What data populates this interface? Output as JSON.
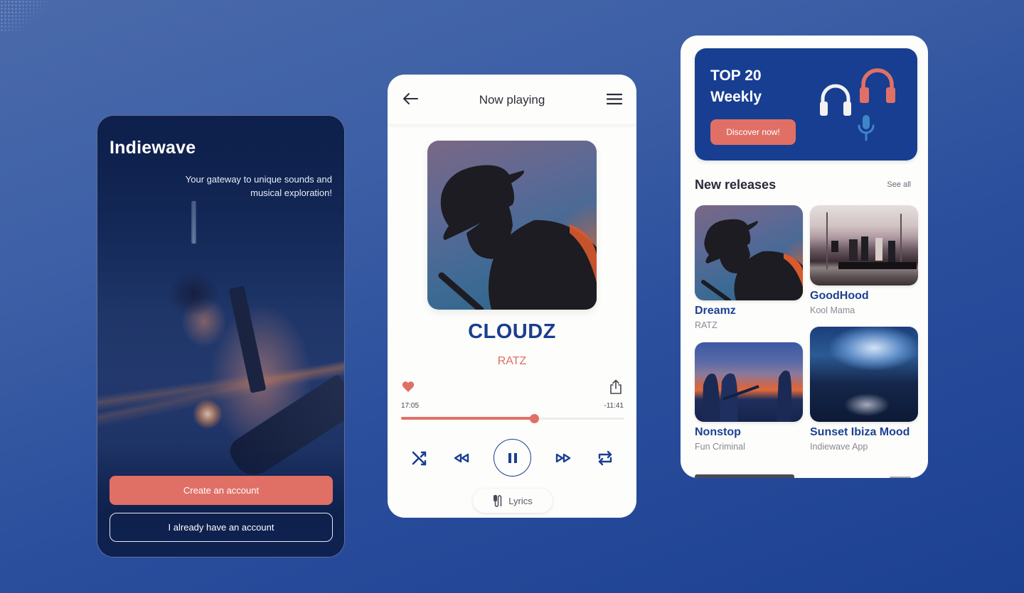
{
  "colors": {
    "primary_blue": "#1a3e8f",
    "coral": "#e07066",
    "dark_navy": "#0f2150",
    "card_bg": "#fdfdfb",
    "mic_blue": "#3f86c8"
  },
  "onboarding": {
    "brand": "Indiewave",
    "tagline": "Your gateway to unique sounds and musical exploration!",
    "create_account_label": "Create an account",
    "login_label": "I already have an account"
  },
  "player": {
    "header": {
      "back_icon": "arrow-left-icon",
      "title": "Now playing",
      "menu_icon": "hamburger-menu-icon"
    },
    "track": {
      "title": "CLOUDZ",
      "artist": "RATZ"
    },
    "liked": true,
    "time_elapsed": "17:05",
    "time_remaining": "-11:41",
    "progress_fraction": 0.594,
    "controls": {
      "shuffle_icon": "shuffle-icon",
      "rewind_icon": "rewind-icon",
      "pause_icon": "pause-icon",
      "forward_icon": "fast-forward-icon",
      "repeat_icon": "repeat-icon"
    },
    "lyrics_label": "Lyrics"
  },
  "home": {
    "promo": {
      "title_line1": "TOP 20",
      "title_line2": "Weekly",
      "cta_label": "Discover now!"
    },
    "new_releases": {
      "title": "New releases",
      "see_all_label": "See all",
      "items": [
        {
          "title": "Dreamz",
          "artist": "RATZ"
        },
        {
          "title": "GoodHood",
          "artist": "Kool Mama"
        },
        {
          "title": "Nonstop",
          "artist": "Fun Criminal"
        },
        {
          "title": "Sunset Ibiza Mood",
          "artist": "Indiewave App"
        }
      ]
    }
  }
}
